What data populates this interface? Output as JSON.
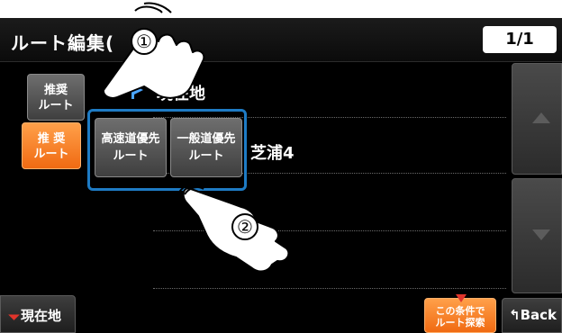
{
  "title_bar": {
    "title": "ルート編集(",
    "title_suffix": ")",
    "page_indicator": "1/1"
  },
  "side_buttons": {
    "recommended_route_top": [
      "推奨",
      "ルート"
    ],
    "recommended_route_active": [
      "推 奨",
      "ルート"
    ]
  },
  "route_list": {
    "current_location": "現在地",
    "destination_fragment": "芝浦4"
  },
  "popup_options": [
    {
      "line1": "高速道優先",
      "line2": "ルート"
    },
    {
      "line1": "一般道優先",
      "line2": "ルート"
    }
  ],
  "bottom_bar": {
    "current_location_button": "現在地",
    "search_button": [
      "この条件で",
      "ルート探索"
    ],
    "back_button": "Back"
  },
  "callouts": {
    "step_1": "①",
    "step_2": "②"
  },
  "colors": {
    "accent_orange": "#f06a12",
    "highlight_blue": "#1e7bc4",
    "flag_blue": "#4aa5ff",
    "marker_red": "#e0342b"
  },
  "icons": {
    "flag": "flag-icon",
    "scroll_up": "triangle-up-icon",
    "scroll_down": "triangle-down-icon",
    "back": "back-arrow-icon",
    "current_location": "location-arrow-icon",
    "pointer_hand": "hand-pointer-icon"
  }
}
